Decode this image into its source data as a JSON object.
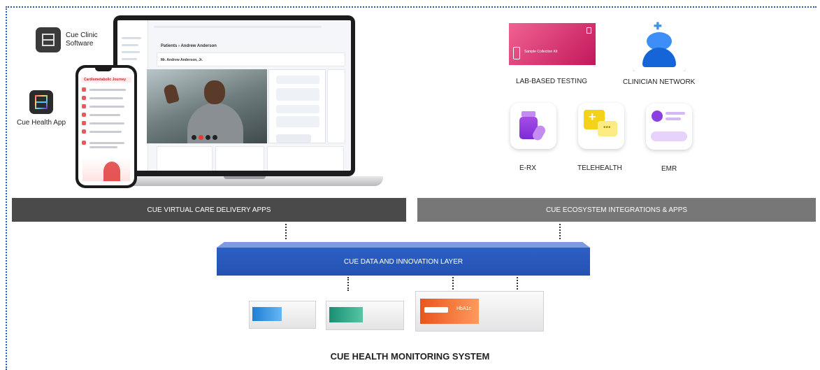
{
  "apps": {
    "clinic_label": "Cue Clinic Software",
    "health_label": "Cue Health App"
  },
  "laptop_screen": {
    "breadcrumb": "Patients › Andrew Anderson",
    "patient_name": "Mr. Andrew Anderson, Jr."
  },
  "phone_screen": {
    "title": "Cardiometabolic Journey"
  },
  "ecosystem": {
    "lab": "LAB-BASED TESTING",
    "lab_kit_text": "Sample Collection Kit",
    "clinician": "CLINICIAN NETWORK",
    "erx": "E-RX",
    "telehealth": "TELEHEALTH",
    "emr": "EMR"
  },
  "bars": {
    "virtual_care": "CUE VIRTUAL CARE DELIVERY APPS",
    "ecosystem": "CUE ECOSYSTEM INTEGRATIONS & APPS",
    "data_layer": "CUE DATA AND INNOVATION LAYER"
  },
  "devices": {
    "hba1c_label": "HbA1c"
  },
  "system_title": "CUE HEALTH MONITORING SYSTEM",
  "colors": {
    "dotted_border": "#2b5fb0",
    "virtual_bar": "#4a4a4a",
    "ecosystem_bar": "#777777",
    "data_layer": "#2d5fc4"
  }
}
